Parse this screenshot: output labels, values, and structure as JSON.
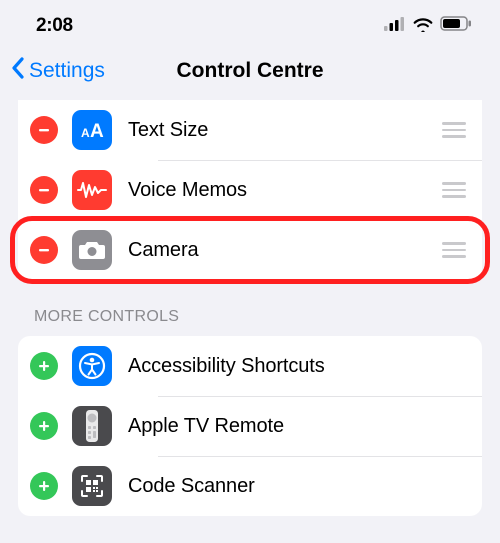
{
  "status": {
    "time": "2:08"
  },
  "nav": {
    "back": "Settings",
    "title": "Control Centre"
  },
  "included": [
    {
      "label": "Text Size",
      "icon": "text-size-icon",
      "icon_bg": "#007aff"
    },
    {
      "label": "Voice Memos",
      "icon": "voice-memos-icon",
      "icon_bg": "#ff3b30"
    },
    {
      "label": "Camera",
      "icon": "camera-icon",
      "icon_bg": "#8e8e93"
    }
  ],
  "more_header": "MORE CONTROLS",
  "more": [
    {
      "label": "Accessibility Shortcuts",
      "icon": "accessibility-icon",
      "icon_bg": "#007aff"
    },
    {
      "label": "Apple TV Remote",
      "icon": "tv-remote-icon",
      "icon_bg": "#8e8e93",
      "dark": true
    },
    {
      "label": "Code Scanner",
      "icon": "code-scanner-icon",
      "icon_bg": "#8e8e93",
      "dark": true
    }
  ],
  "highlighted_row_index": 2
}
